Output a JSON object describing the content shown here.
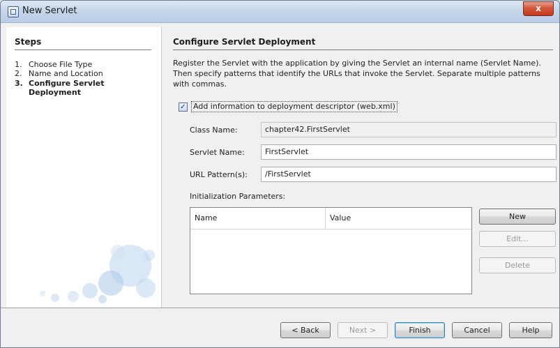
{
  "window": {
    "title": "New Servlet",
    "close_glyph": "x"
  },
  "steps": {
    "heading": "Steps",
    "items": [
      {
        "num": "1.",
        "label": "Choose File Type"
      },
      {
        "num": "2.",
        "label": "Name and Location"
      },
      {
        "num": "3.",
        "label": "Configure Servlet Deployment"
      }
    ]
  },
  "main": {
    "heading": "Configure Servlet Deployment",
    "description": "Register the Servlet with the application by giving the Servlet an internal name (Servlet Name). Then specify patterns that identify the URLs that invoke the Servlet. Separate multiple patterns with commas.",
    "checkbox": {
      "label": "Add information to deployment descriptor (web.xml)",
      "checked": true
    },
    "fields": {
      "class_name": {
        "label": "Class Name:",
        "value": "chapter42.FirstServlet"
      },
      "servlet_name": {
        "label": "Servlet Name:",
        "value": "FirstServlet"
      },
      "url_pattern": {
        "label": "URL Pattern(s):",
        "value": "/FirstServlet"
      }
    },
    "init_params": {
      "label": "Initialization Parameters:",
      "columns": [
        "Name",
        "Value"
      ]
    },
    "side_buttons": {
      "new": "New",
      "edit": "Edit...",
      "delete": "Delete"
    }
  },
  "footer": {
    "back": "< Back",
    "next": "Next >",
    "finish": "Finish",
    "cancel": "Cancel",
    "help": "Help"
  }
}
